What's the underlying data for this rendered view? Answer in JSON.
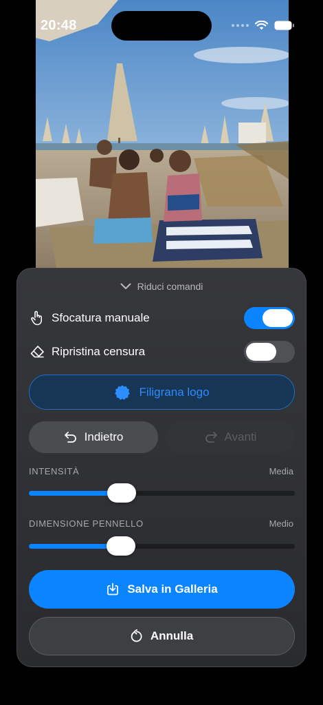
{
  "status_bar": {
    "time": "20:48"
  },
  "panel": {
    "collapse_label": "Riduci comandi",
    "manual_blur": {
      "label": "Sfocatura manuale",
      "enabled": true
    },
    "restore_censor": {
      "label": "Ripristina censura",
      "enabled": false
    },
    "watermark_label": "Filigrana logo",
    "undo_label": "Indietro",
    "redo_label": "Avanti",
    "intensity": {
      "label": "INTENSITÀ",
      "value_label": "Media",
      "level": 0.35
    },
    "brush_size": {
      "label": "DIMENSIONE PENNELLO",
      "value_label": "Medio",
      "level": 0.345
    },
    "save_label": "Salva in Galleria",
    "cancel_label": "Annulla"
  },
  "colors": {
    "accent": "#0a84ff",
    "panel": "#2f3033",
    "disabled_text": "#5d5e62"
  }
}
